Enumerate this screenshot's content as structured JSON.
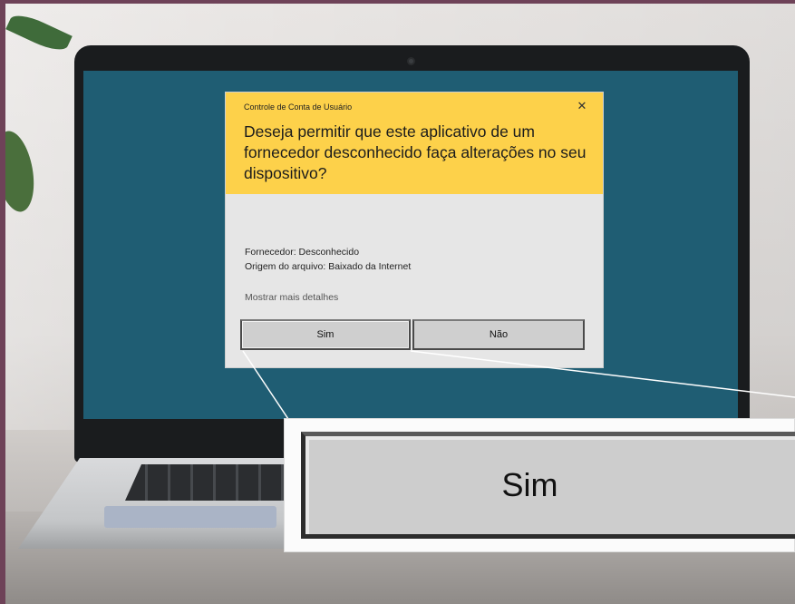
{
  "dialog": {
    "title": "Controle de Conta de Usuário",
    "close_glyph": "✕",
    "question": "Deseja permitir que este aplicativo de um fornecedor desconhecido faça alterações no seu dispositivo?",
    "publisher": "Fornecedor: Desconhecido",
    "file_origin": "Origem do arquivo: Baixado da Internet",
    "more_details": "Mostrar mais detalhes",
    "yes_label": "Sim",
    "no_label": "Não"
  },
  "zoom": {
    "label": "Sim"
  },
  "colors": {
    "header_accent": "#fdd14a",
    "desktop": "#1f5d73",
    "frame": "#6e4258"
  }
}
